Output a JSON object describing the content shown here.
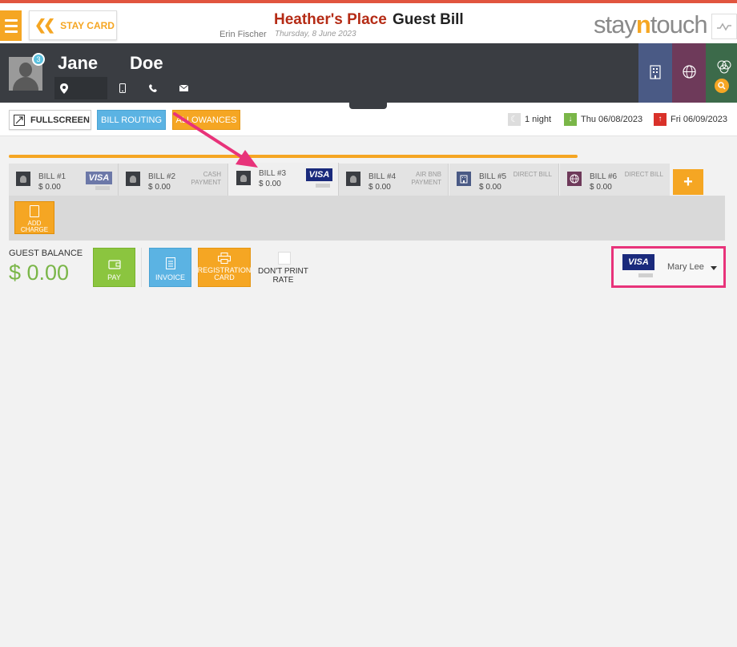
{
  "header": {
    "back_label": "STAY CARD",
    "hotel_name": "Heather's Place",
    "page_title": "Guest Bill",
    "user_name": "Erin Fischer",
    "date": "Thursday, 8 June 2023",
    "logo_left": "stay",
    "logo_mid": "n",
    "logo_right": "touch"
  },
  "guest": {
    "first_name": "Jane",
    "last_name": "Doe",
    "badge_count": "3"
  },
  "actions": {
    "fullscreen_label": "FULLSCREEN",
    "routing_label": "BILL ROUTING",
    "allowances_label": "ALLOWANCES"
  },
  "stay": {
    "nights": "1 night",
    "arrival": "Thu 06/08/2023",
    "departure": "Fri 06/09/2023"
  },
  "bills": [
    {
      "name": "BILL #1",
      "amount": "$ 0.00",
      "payment": "VISA"
    },
    {
      "name": "BILL #2",
      "amount": "$ 0.00",
      "payment": "CASH PAYMENT"
    },
    {
      "name": "BILL #3",
      "amount": "$ 0.00",
      "payment": "VISA"
    },
    {
      "name": "BILL #4",
      "amount": "$ 0.00",
      "payment": "AIR BNB PAYMENT"
    },
    {
      "name": "BILL #5",
      "amount": "$ 0.00",
      "payment": "DIRECT BILL"
    },
    {
      "name": "BILL #6",
      "amount": "$ 0.00",
      "payment": "DIRECT BILL"
    }
  ],
  "add_bill_label": "+",
  "charge": {
    "add_label_1": "ADD",
    "add_label_2": "CHARGE"
  },
  "balance": {
    "label": "GUEST BALANCE",
    "value": "$ 0.00"
  },
  "bill_actions": {
    "pay_label": "PAY",
    "invoice_label": "INVOICE",
    "registration_label_1": "REGISTRATION",
    "registration_label_2": "CARD",
    "dont_print_1": "DON'T PRINT",
    "dont_print_2": "RATE"
  },
  "card": {
    "brand": "VISA",
    "holder": "Mary Lee"
  },
  "colors": {
    "accent_orange": "#f5a623",
    "hotel_red": "#b52b15",
    "highlight_pink": "#e8337a",
    "balance_green": "#7ab648",
    "visa_blue": "#1a2a7c"
  }
}
